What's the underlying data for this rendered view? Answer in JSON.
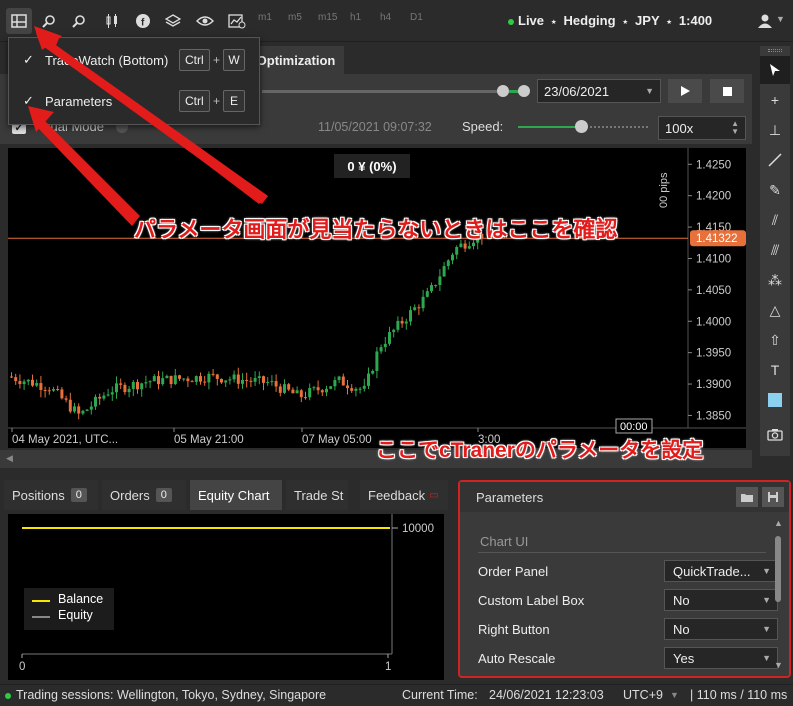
{
  "toolbar": {
    "timeframes": [
      "m1",
      "m5",
      "m15",
      "h1",
      "h4",
      "D1"
    ],
    "account": "Live",
    "account_mode": "Hedging",
    "currency": "JPY",
    "leverage": "1:400",
    "separator": "⋆"
  },
  "menu": {
    "items": [
      {
        "label": "TradeWatch (Bottom)",
        "checked": true,
        "key1": "Ctrl",
        "key2": "W"
      },
      {
        "label": "Parameters",
        "checked": true,
        "key1": "Ctrl",
        "key2": "E"
      }
    ],
    "plus": "+"
  },
  "tabs": {
    "optimization": "Optimization"
  },
  "controls": {
    "date": "23/06/2021",
    "visual_mode_label": "sual Mode",
    "timestamp": "11/05/2021 09:07:32",
    "speed_label": "Speed:",
    "speed_value": "100x"
  },
  "chart": {
    "pnl": "0 ¥ (0%)",
    "pips_label": "00 pips",
    "current_price": "1.41322",
    "price_ticks": [
      "1.4250",
      "1.4200",
      "1.4150",
      "1.4100",
      "1.4050",
      "1.4000",
      "1.3950",
      "1.3900",
      "1.3850"
    ],
    "time_ticks": [
      "04 May 2021, UTC...",
      "05 May 21:00",
      "07 May 05:00",
      "3:00"
    ],
    "cursor_time": "00:00"
  },
  "annotations": {
    "top": "パラメータ画面が見当たらないときはここを確認",
    "bottom": "ここでcTranerのパラメータを設定"
  },
  "bottom_tabs": [
    {
      "label": "Positions",
      "count": "0"
    },
    {
      "label": "Orders",
      "count": "0"
    },
    {
      "label": "Equity Chart",
      "count": ""
    },
    {
      "label": "Trade St",
      "count": ""
    }
  ],
  "feedback": "Feedback",
  "equity": {
    "level_label": "10000",
    "legend": [
      {
        "name": "Balance",
        "color": "#f5e700"
      },
      {
        "name": "Equity",
        "color": "#888888"
      }
    ],
    "x_start": "0",
    "x_end": "1"
  },
  "params": {
    "title": "Parameters",
    "section": "Chart UI",
    "rows": [
      {
        "label": "Order Panel",
        "value": "QuickTrade..."
      },
      {
        "label": "Custom Label Box",
        "value": "No"
      },
      {
        "label": "Right Button",
        "value": "No"
      },
      {
        "label": "Auto Rescale",
        "value": "Yes"
      }
    ]
  },
  "status": {
    "sessions": "Trading sessions: Wellington, Tokyo, Sydney, Singapore",
    "current_time_label": "Current Time:",
    "current_time": "24/06/2021 12:23:03",
    "timezone": "UTC+9",
    "latency": "| 110 ms / 110 ms"
  },
  "colors": {
    "accent_red": "#e21b1b",
    "bull": "#2ea84f",
    "bear": "#e8703a",
    "price_tag": "#e8703a"
  },
  "icons": [
    "layout-icon",
    "zoom-out-icon",
    "zoom-in-icon",
    "candles-icon",
    "facebook-icon",
    "layers-icon",
    "eye-icon",
    "chart-settings-icon",
    "user-icon"
  ]
}
